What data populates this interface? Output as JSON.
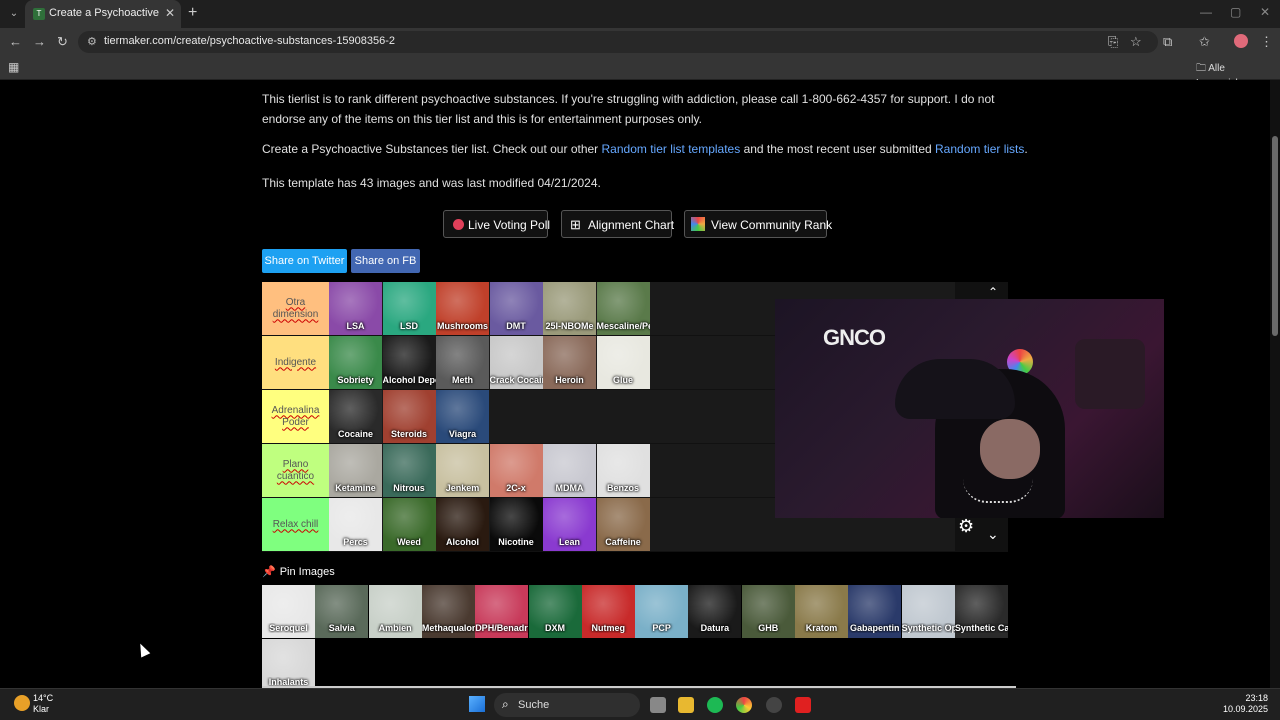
{
  "browser": {
    "tab_title": "Create a Psychoactive Substances",
    "tab_close": "✕",
    "new_tab": "+",
    "url": "tiermaker.com/create/psychoactive-substances-15908356-2",
    "bookmarks_label": "Alle Lesezeichen"
  },
  "page": {
    "intro": "This tierlist is to rank different psychoactive substances. If you're struggling with addiction, please call 1-800-662-4357 for support. I do not endorse any of the items on this tier list and this is for entertainment purposes only.",
    "create_prefix": "Create a Psychoactive Substances tier list. Check out our other ",
    "create_link1": "Random tier list templates",
    "create_middle": " and the most recent user submitted ",
    "create_link2": "Random tier lists",
    "create_suffix": ".",
    "template_info": "This template has 43 images and was last modified 04/21/2024.",
    "actions": {
      "live_voting": "Live Voting Poll",
      "alignment": "Alignment Chart",
      "community": "View Community Rank"
    },
    "share_twitter": "Share on Twitter",
    "share_fb": "Share on FB",
    "pin_title": "Pin Images"
  },
  "tiers": [
    {
      "label": "Otra dimension",
      "color": "#ffbf7f",
      "items": [
        {
          "name": "LSA",
          "bg": "#8a4aa8"
        },
        {
          "name": "LSD",
          "bg": "#2aa880"
        },
        {
          "name": "Mushrooms",
          "bg": "#c0402a"
        },
        {
          "name": "DMT",
          "bg": "#6a5aa0"
        },
        {
          "name": "25I-NBOMe",
          "bg": "#9a9a7a"
        },
        {
          "name": "Mescaline/Peyote",
          "bg": "#5a7a4a"
        }
      ]
    },
    {
      "label": "Indigente",
      "color": "#ffdf7f",
      "items": [
        {
          "name": "Sobriety",
          "bg": "#3a8a4a"
        },
        {
          "name": "Alcohol Dependence",
          "bg": "#1a1a1a"
        },
        {
          "name": "Meth",
          "bg": "#5a5a5a"
        },
        {
          "name": "Crack Cocaine",
          "bg": "#c8c8c8"
        },
        {
          "name": "Heroin",
          "bg": "#8a6a5a"
        },
        {
          "name": "Glue",
          "bg": "#e8e8e0"
        }
      ]
    },
    {
      "label": "Adrenalina Poder",
      "color": "#ffff7f",
      "items": [
        {
          "name": "Cocaine",
          "bg": "#2a2a2a"
        },
        {
          "name": "Steroids",
          "bg": "#a04030"
        },
        {
          "name": "Viagra",
          "bg": "#2a4a7a"
        }
      ]
    },
    {
      "label": "Plano cuantico",
      "color": "#bfff7f",
      "items": [
        {
          "name": "Ketamine",
          "bg": "#aaa8a0"
        },
        {
          "name": "Nitrous",
          "bg": "#3a6a5a"
        },
        {
          "name": "Jenkem",
          "bg": "#c8c0a0"
        },
        {
          "name": "2C-x",
          "bg": "#d07a6a"
        },
        {
          "name": "MDMA",
          "bg": "#c8c8d0"
        },
        {
          "name": "Benzos",
          "bg": "#e0e0e0"
        }
      ]
    },
    {
      "label": "Relax chill",
      "color": "#7fff7f",
      "items": [
        {
          "name": "Percs",
          "bg": "#e8e8e8"
        },
        {
          "name": "Weed",
          "bg": "#3a6a2a"
        },
        {
          "name": "Alcohol",
          "bg": "#2a1a10"
        },
        {
          "name": "Nicotine",
          "bg": "#0a0a0a"
        },
        {
          "name": "Lean",
          "bg": "#8a3ad0"
        },
        {
          "name": "Caffeine",
          "bg": "#8a6a4a"
        }
      ]
    }
  ],
  "pins": [
    {
      "name": "Seroquel",
      "bg": "#e8e8e8"
    },
    {
      "name": "Salvia",
      "bg": "#5a6a5a"
    },
    {
      "name": "Ambien",
      "bg": "#c8d0c8"
    },
    {
      "name": "Methaqualone",
      "bg": "#4a3a30"
    },
    {
      "name": "DPH/Benadryl",
      "bg": "#c83a5a"
    },
    {
      "name": "DXM",
      "bg": "#1a6a3a"
    },
    {
      "name": "Nutmeg",
      "bg": "#c82a2a"
    },
    {
      "name": "PCP",
      "bg": "#7ab0c8"
    },
    {
      "name": "Datura",
      "bg": "#1a1a1a"
    },
    {
      "name": "GHB",
      "bg": "#4a5a3a"
    },
    {
      "name": "Kratom",
      "bg": "#8a7a4a"
    },
    {
      "name": "Gabapentin",
      "bg": "#2a3a6a"
    },
    {
      "name": "Synthetic Opioids",
      "bg": "#c0c8d0"
    },
    {
      "name": "Synthetic Cathinones",
      "bg": "#2a2a2a"
    },
    {
      "name": "Inhalants",
      "bg": "#d8d8d8"
    }
  ],
  "taskbar": {
    "weather_temp": "14°C",
    "weather_desc": "Klar",
    "search_label": "Suche",
    "time": "23:18",
    "date": "10.09.2025"
  },
  "stream": {
    "logo": "GNCO"
  },
  "icons": {
    "menu_dropdown": "chevron-down-icon",
    "back": "back-arrow-icon",
    "forward": "forward-arrow-icon",
    "reload": "reload-icon",
    "translate": "translate-icon",
    "star": "star-icon",
    "extensions": "puzzle-icon",
    "gear": "gear-icon",
    "pin": "pin-icon"
  }
}
